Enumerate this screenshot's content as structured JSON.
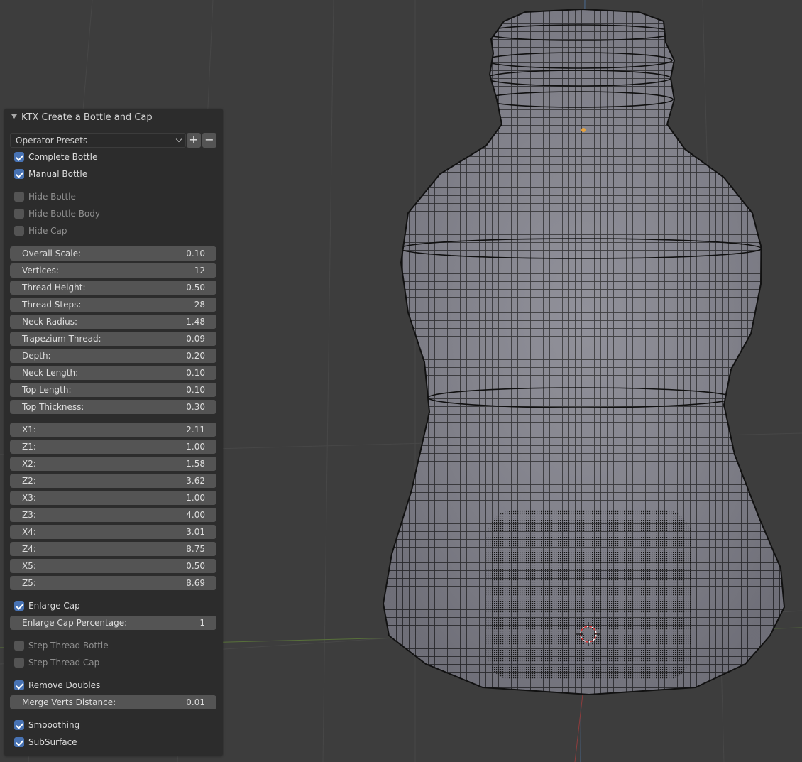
{
  "panel": {
    "title": "KTX Create a Bottle and Cap",
    "presets_label": "Operator Presets",
    "add_preset_symbol": "+",
    "remove_preset_symbol": "−"
  },
  "checkboxes": [
    {
      "label": "Complete Bottle",
      "checked": true
    },
    {
      "label": "Manual Bottle",
      "checked": true
    },
    {
      "label": "Hide Bottle",
      "checked": false
    },
    {
      "label": "Hide Bottle Body",
      "checked": false
    },
    {
      "label": "Hide Cap",
      "checked": false
    },
    {
      "label": "Enlarge Cap",
      "checked": true
    },
    {
      "label": "Step Thread Bottle",
      "checked": false
    },
    {
      "label": "Step Thread Cap",
      "checked": false
    },
    {
      "label": "Remove Doubles",
      "checked": true
    },
    {
      "label": "Smooothing",
      "checked": true
    },
    {
      "label": "SubSurface",
      "checked": true
    }
  ],
  "fields": [
    {
      "label": "Overall Scale:",
      "value": "0.10"
    },
    {
      "label": "Vertices:",
      "value": "12"
    },
    {
      "label": "Thread Height:",
      "value": "0.50"
    },
    {
      "label": "Thread Steps:",
      "value": "28"
    },
    {
      "label": "Neck Radius:",
      "value": "1.48"
    },
    {
      "label": "Trapezium Thread:",
      "value": "0.09"
    },
    {
      "label": "Depth:",
      "value": "0.20"
    },
    {
      "label": "Neck Length:",
      "value": "0.10"
    },
    {
      "label": "Top Length:",
      "value": "0.10"
    },
    {
      "label": "Top Thickness:",
      "value": "0.30"
    },
    {
      "label": "X1:",
      "value": "2.11"
    },
    {
      "label": "Z1:",
      "value": "1.00"
    },
    {
      "label": "X2:",
      "value": "1.58"
    },
    {
      "label": "Z2:",
      "value": "3.62"
    },
    {
      "label": "X3:",
      "value": "1.00"
    },
    {
      "label": "Z3:",
      "value": "4.00"
    },
    {
      "label": "X4:",
      "value": "3.01"
    },
    {
      "label": "Z4:",
      "value": "8.75"
    },
    {
      "label": "X5:",
      "value": "0.50"
    },
    {
      "label": "Z5:",
      "value": "8.69"
    },
    {
      "label": "Enlarge Cap Percentage:",
      "value": "1"
    },
    {
      "label": "Merge Verts Distance:",
      "value": "0.01"
    }
  ],
  "colors": {
    "viewport_bg": "#3d3d3d",
    "mesh_fill": "#8a8a93",
    "wire": "#141414",
    "checkbox_on": "#4772b3",
    "field_bg": "#545454",
    "panel_bg": "#2c2c2c"
  }
}
